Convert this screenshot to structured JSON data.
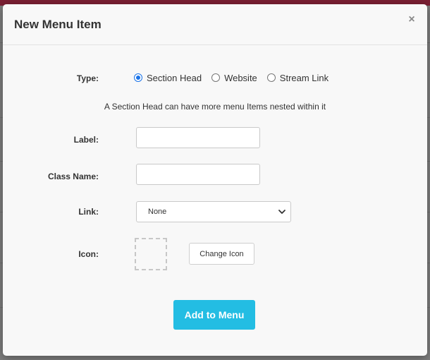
{
  "modal": {
    "title": "New Menu Item",
    "close_glyph": "×"
  },
  "form": {
    "type_label": "Type:",
    "type_options": [
      {
        "label": "Section Head",
        "checked": true
      },
      {
        "label": "Website",
        "checked": false
      },
      {
        "label": "Stream Link",
        "checked": false
      }
    ],
    "help_text": "A Section Head can have more menu Items nested within it",
    "label_label": "Label:",
    "label_value": "",
    "classname_label": "Class Name:",
    "classname_value": "",
    "link_label": "Link:",
    "link_selected": "None",
    "icon_label": "Icon:",
    "change_icon_label": "Change Icon",
    "submit_label": "Add to Menu"
  },
  "colors": {
    "accent_button": "#23bde3",
    "radio_selected": "#1a73e8",
    "top_bar": "#7a1f33"
  }
}
